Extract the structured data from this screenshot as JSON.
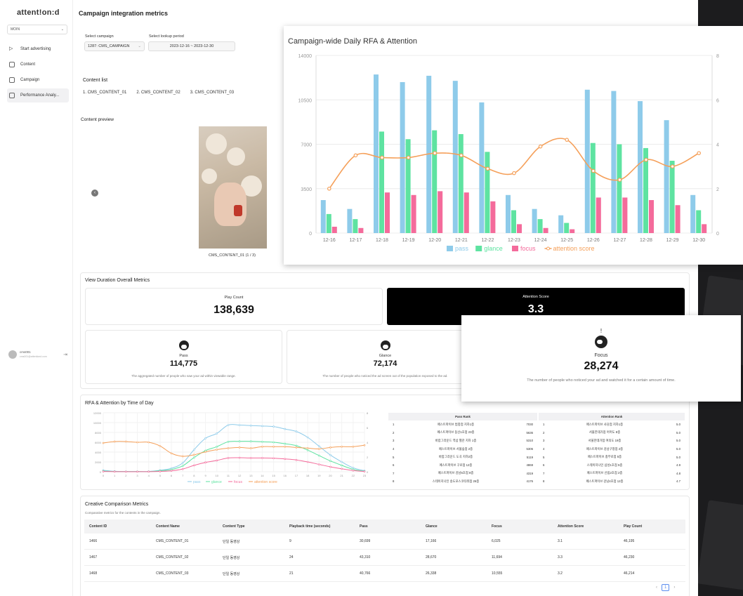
{
  "app": {
    "logo": "attent!on:d",
    "title": "Campaign integration metrics"
  },
  "sidebar": {
    "org": "MOIN",
    "items": [
      {
        "label": "Start advertising",
        "icon": "play-icon"
      },
      {
        "label": "Content",
        "icon": "content-icon"
      },
      {
        "label": "Campaign",
        "icon": "calendar-icon"
      },
      {
        "label": "Performance Analy...",
        "icon": "monitor-icon"
      }
    ],
    "user": {
      "name": "cms001",
      "email": "cms001@attentiond.com"
    }
  },
  "filters": {
    "campaign_label": "Select campaign",
    "campaign_value": "1287: CMS_CAMPAIGN",
    "period_label": "Select lookup period",
    "period_value": "2023-12-16 ~ 2023-12-30"
  },
  "content_list": {
    "title": "Content list",
    "items": [
      "1. CMS_CONTENT_01",
      "2. CMS_CONTENT_02",
      "3. CMS_CONTENT_03"
    ]
  },
  "preview": {
    "title": "Content preview",
    "caption": "CMS_CONTENT_01 (1 / 3)"
  },
  "daily_chart": {
    "title": "Campaign-wide Daily RFA & Attention",
    "legend": [
      "pass",
      "glance",
      "focus",
      "attention score"
    ]
  },
  "overall": {
    "title": "View Duration Overall Metrics",
    "play_count_label": "Play Count",
    "play_count": "138,639",
    "attention_label": "Attention Score",
    "attention_score": "3.3",
    "pass_label": "Pass",
    "pass_value": "114,775",
    "pass_desc": "The aggregated number of people who saw your ad within viewable range.",
    "glance_label": "Glance",
    "glance_value": "72,174",
    "glance_desc": "The number of people who noticed the ad screen out of the population exposed to the ad.",
    "focus_label": "Focus",
    "focus_value": "28,274",
    "focus_desc": "The number of people who noticed your ad and watched it for a certain amount of time."
  },
  "time_chart": {
    "title": "RFA & Attention by Time of Day",
    "legend": [
      "pass",
      "glance",
      "focus",
      "attention score"
    ]
  },
  "pass_rank": {
    "title": "Pass Rank",
    "rows": [
      [
        "1",
        "페스트파이브 범창점 지하1층",
        "7030"
      ],
      [
        "2",
        "페스트파이브 동산1호점 23층",
        "5636"
      ],
      [
        "3",
        "바랍그라운드 역삼 별관 지하 1층",
        "5310"
      ],
      [
        "4",
        "페스트파이브 서울숲점 2층",
        "5306"
      ],
      [
        "5",
        "바랍그라운드 도곡 지하2층",
        "5119"
      ],
      [
        "6",
        "페스트파이브 구로점 12층",
        "4869"
      ],
      [
        "7",
        "페스트파이브 강남5호점 8층",
        "4319"
      ],
      [
        "8",
        "스테이지나인 송도포스코타워점 26층",
        "4176"
      ]
    ]
  },
  "attention_rank": {
    "title": "Attention Rank",
    "rows": [
      [
        "1",
        "페스트파이브 사당점 지하1층",
        "5.0"
      ],
      [
        "2",
        "서울한데가점 어머도 8층",
        "5.0"
      ],
      [
        "3",
        "서울한데가점 여의도 19층",
        "5.0"
      ],
      [
        "4",
        "페스트파이브 강남구청점 2층",
        "5.0"
      ],
      [
        "5",
        "페스트파이브 충무로점 5층",
        "5.0"
      ],
      [
        "6",
        "스테이지나인 삼성1호점 5층",
        "4.9"
      ],
      [
        "7",
        "페스트파이브 신림2호점 2층",
        "4.8"
      ],
      [
        "8",
        "페스트파이브 강남4호점 12층",
        "4.7"
      ]
    ]
  },
  "creative": {
    "title": "Creative Comparison Metrics",
    "subtitle": "Comparative metrics for the contents in the campaign.",
    "headers": [
      "Content ID",
      "Content Name",
      "Content Type",
      "Playback time (seconds)",
      "Pass",
      "Glance",
      "Focus",
      "Attention Score",
      "Play Count"
    ],
    "rows": [
      [
        "1466",
        "CMS_CONTENT_01",
        "단일 동영상",
        "9",
        "30,699",
        "17,166",
        "6,025",
        "3.1",
        "46,195"
      ],
      [
        "1467",
        "CMS_CONTENT_02",
        "단일 동영상",
        "24",
        "43,310",
        "28,670",
        "11,694",
        "3.3",
        "46,230"
      ],
      [
        "1468",
        "CMS_CONTENT_03",
        "단일 동영상",
        "21",
        "40,766",
        "26,338",
        "10,555",
        "3.2",
        "46,214"
      ]
    ],
    "page": "1"
  },
  "chart_data": [
    {
      "type": "bar",
      "title": "Campaign-wide Daily RFA & Attention",
      "categories": [
        "12-16",
        "12-17",
        "12-18",
        "12-19",
        "12-20",
        "12-21",
        "12-22",
        "12-23",
        "12-24",
        "12-25",
        "12-26",
        "12-27",
        "12-28",
        "12-29",
        "12-30"
      ],
      "ylim": [
        0,
        14000
      ],
      "y2lim": [
        0,
        8
      ],
      "yticks": [
        0,
        3500,
        7000,
        10500,
        14000
      ],
      "y2ticks": [
        0,
        2,
        4,
        6,
        8
      ],
      "colors": {
        "pass": "#8ecbea",
        "glance": "#5ee3a1",
        "focus": "#f46b9b",
        "attention score": "#f5a05a"
      },
      "series": [
        {
          "name": "pass",
          "values": [
            2600,
            1900,
            12500,
            11900,
            12400,
            12000,
            10300,
            3000,
            1900,
            1400,
            11300,
            11200,
            10400,
            8900,
            3000
          ]
        },
        {
          "name": "glance",
          "values": [
            1500,
            1100,
            8000,
            7400,
            8100,
            7800,
            6400,
            1800,
            1100,
            800,
            7100,
            7000,
            6700,
            5700,
            1800
          ]
        },
        {
          "name": "focus",
          "values": [
            500,
            400,
            3200,
            3000,
            3300,
            3200,
            2500,
            700,
            400,
            300,
            2800,
            2800,
            2600,
            2200,
            700
          ]
        },
        {
          "name": "attention score",
          "axis": "right",
          "values": [
            2.0,
            3.5,
            3.4,
            3.4,
            3.6,
            3.5,
            2.9,
            2.7,
            3.9,
            4.2,
            2.8,
            2.4,
            3.3,
            3.0,
            3.6
          ]
        }
      ]
    },
    {
      "type": "line",
      "title": "RFA & Attention by Time of Day",
      "x": [
        0,
        1,
        2,
        3,
        4,
        5,
        6,
        7,
        8,
        9,
        10,
        11,
        12,
        13,
        14,
        15,
        16,
        17,
        18,
        19,
        20,
        21,
        22,
        23
      ],
      "ylim": [
        0,
        12000
      ],
      "y2lim": [
        0,
        8
      ],
      "yticks": [
        0,
        2000,
        4000,
        6000,
        8000,
        10000,
        12000
      ],
      "y2ticks": [
        0,
        2,
        4,
        6,
        8
      ],
      "series": [
        {
          "name": "pass",
          "values": [
            300,
            100,
            50,
            50,
            60,
            300,
            700,
            1800,
            4500,
            6800,
            7800,
            9500,
            9500,
            9400,
            9300,
            9200,
            8700,
            8200,
            7000,
            5200,
            3400,
            2000,
            800,
            200
          ]
        },
        {
          "name": "glance",
          "values": [
            150,
            60,
            30,
            30,
            40,
            200,
            450,
            1200,
            2900,
            4300,
            5100,
            6100,
            6200,
            6200,
            6100,
            6000,
            5700,
            5300,
            4400,
            3300,
            2200,
            1300,
            500,
            100
          ]
        },
        {
          "name": "focus",
          "values": [
            60,
            20,
            10,
            10,
            20,
            80,
            200,
            550,
            1300,
            1900,
            2300,
            2800,
            2850,
            2800,
            2800,
            2750,
            2600,
            2400,
            2000,
            1500,
            1000,
            600,
            250,
            50
          ]
        },
        {
          "name": "attention score",
          "axis": "right",
          "values": [
            3.9,
            4.1,
            4.1,
            4.0,
            4.0,
            3.5,
            2.5,
            2.1,
            2.3,
            2.7,
            3.0,
            3.2,
            3.3,
            3.2,
            3.4,
            3.4,
            3.4,
            3.3,
            3.2,
            3.1,
            3.3,
            3.4,
            3.4,
            3.6
          ]
        }
      ]
    }
  ]
}
